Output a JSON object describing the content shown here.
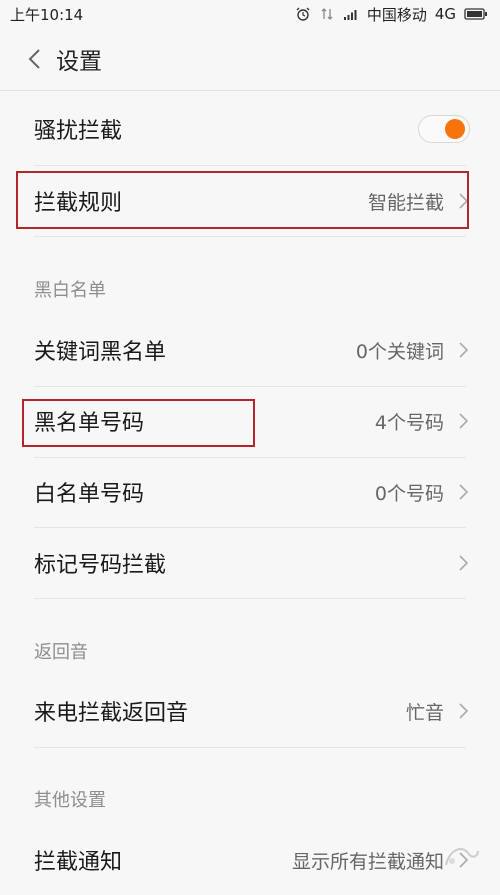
{
  "status_bar": {
    "time": "上午10:14",
    "carrier": "中国移动",
    "network": "4G"
  },
  "header": {
    "title": "设置"
  },
  "rows": {
    "harass_block": {
      "label": "骚扰拦截",
      "toggle_on": true
    },
    "block_rules": {
      "label": "拦截规则",
      "value": "智能拦截"
    },
    "keyword_blacklist": {
      "label": "关键词黑名单",
      "value": "0个关键词"
    },
    "blacklist_numbers": {
      "label": "黑名单号码",
      "value": "4个号码"
    },
    "whitelist_numbers": {
      "label": "白名单号码",
      "value": "0个号码"
    },
    "marked_numbers": {
      "label": "标记号码拦截"
    },
    "busy_tone": {
      "label": "来电拦截返回音",
      "value": "忙音"
    },
    "block_notify": {
      "label": "拦截通知",
      "value": "显示所有拦截通知"
    }
  },
  "sections": {
    "blackwhite": "黑白名单",
    "return_tone": "返回音",
    "other": "其他设置"
  },
  "colors": {
    "accent": "#f7740d",
    "highlight": "#b3262d",
    "background": "#f7f7f7"
  }
}
